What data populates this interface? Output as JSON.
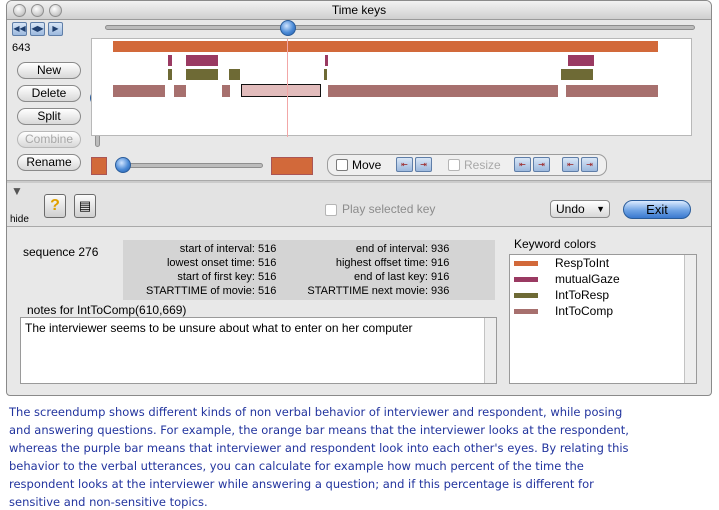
{
  "window": {
    "title": "Time keys"
  },
  "playback": {
    "buttons": [
      {
        "name": "rewind-button",
        "icon": "◀◀"
      },
      {
        "name": "play-back-button",
        "icon": "◀▶"
      },
      {
        "name": "play-button",
        "icon": "▶"
      }
    ],
    "position": 0.31
  },
  "counter": "643",
  "timeline": {
    "colors": {
      "resp_to_int": "#d2693a",
      "mutual_gaze": "#9a3a62",
      "int_to_resp": "#6e6a35",
      "int_to_comp": "#a7706e",
      "selected": "#e2bcbc"
    }
  },
  "buttons": {
    "new": "New",
    "delete": "Delete",
    "split": "Split",
    "combine": "Combine",
    "rename": "Rename"
  },
  "tools": {
    "move": "Move",
    "resize": "Resize"
  },
  "hide_row": {
    "hide": "hide",
    "play_selected": "Play selected key",
    "undo": "Undo",
    "exit": "Exit"
  },
  "sequence": "sequence 276",
  "info": {
    "start_of_interval_label": "start of interval:",
    "start_of_interval": "516",
    "lowest_onset_label": "lowest onset time:",
    "lowest_onset": "516",
    "start_first_key_label": "start of first key:",
    "start_first_key": "516",
    "starttime_movie_label": "STARTTIME of movie:",
    "starttime_movie": "516",
    "end_of_interval_label": "end of interval:",
    "end_of_interval": "936",
    "highest_offset_label": "highest offset time:",
    "highest_offset": "916",
    "end_last_key_label": "end of last key:",
    "end_last_key": "916",
    "starttime_next_label": "STARTTIME next movie:",
    "starttime_next": "936"
  },
  "notes": {
    "label": "notes for IntToComp(610,669)",
    "text": "The interviewer seems to be unsure about what to enter on her computer"
  },
  "keywords": {
    "title": "Keyword colors",
    "items": [
      {
        "label": "RespToInt",
        "color": "#d2693a"
      },
      {
        "label": "mutualGaze",
        "color": "#9a3a62"
      },
      {
        "label": "IntToResp",
        "color": "#6e6a35"
      },
      {
        "label": "IntToComp",
        "color": "#a7706e"
      }
    ]
  },
  "description": {
    "lines": [
      "The screendump shows different kinds of non verbal behavior of interviewer and respondent, while posing",
      "and answering questions. For example, the orange bar means that the interviewer looks at the respondent,",
      "whereas the purple bar means that interviewer and respondent look into each other's eyes. By relating this",
      "behavior to the verbal utterances, you can calculate for example how much percent of the time the",
      "respondent looks at the interviewer while answering a question; and if this percentage is different for",
      "sensitive and non-sensitive topics."
    ]
  }
}
